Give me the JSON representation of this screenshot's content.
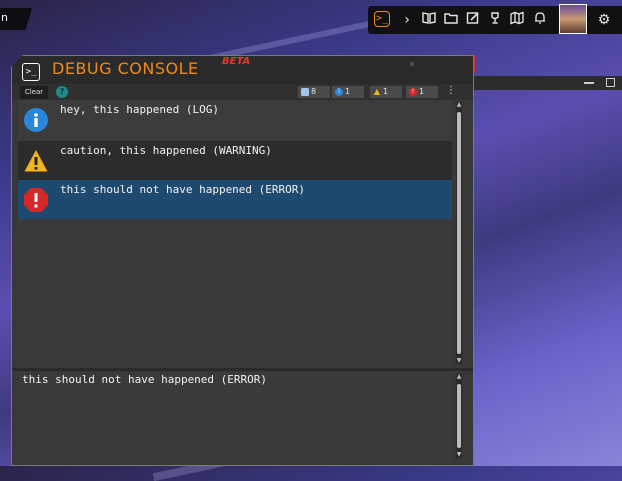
{
  "topbar": {
    "left_text": "n",
    "icons": [
      "console-icon",
      "chevron-right-icon",
      "book-icon",
      "folder-icon",
      "edit-icon",
      "trophy-icon",
      "map-icon",
      "bell-icon",
      "avatar",
      "gear-icon"
    ]
  },
  "console": {
    "title": "DEBUG CONSOLE",
    "badge": "BETA",
    "toolbar": {
      "clear_label": "Clear",
      "help_label": "?",
      "counts": {
        "all": "8",
        "log": "1",
        "warning": "1",
        "error": "1"
      }
    },
    "entries": [
      {
        "type": "log",
        "icon": "info-icon",
        "message": "hey, this happened (LOG)"
      },
      {
        "type": "warning",
        "icon": "warning-icon",
        "message": "caution, this happened (WARNING)"
      },
      {
        "type": "error",
        "icon": "error-icon",
        "message": "this should not have happened (ERROR)"
      }
    ],
    "selected_detail": "this should not have happened (ERROR)"
  },
  "colors": {
    "accent": "#f08a1e",
    "beta": "#e23a2a",
    "selected_row": "#1f4a70",
    "info": "#2a86d6",
    "warning": "#f2b51c",
    "error": "#d62828"
  }
}
